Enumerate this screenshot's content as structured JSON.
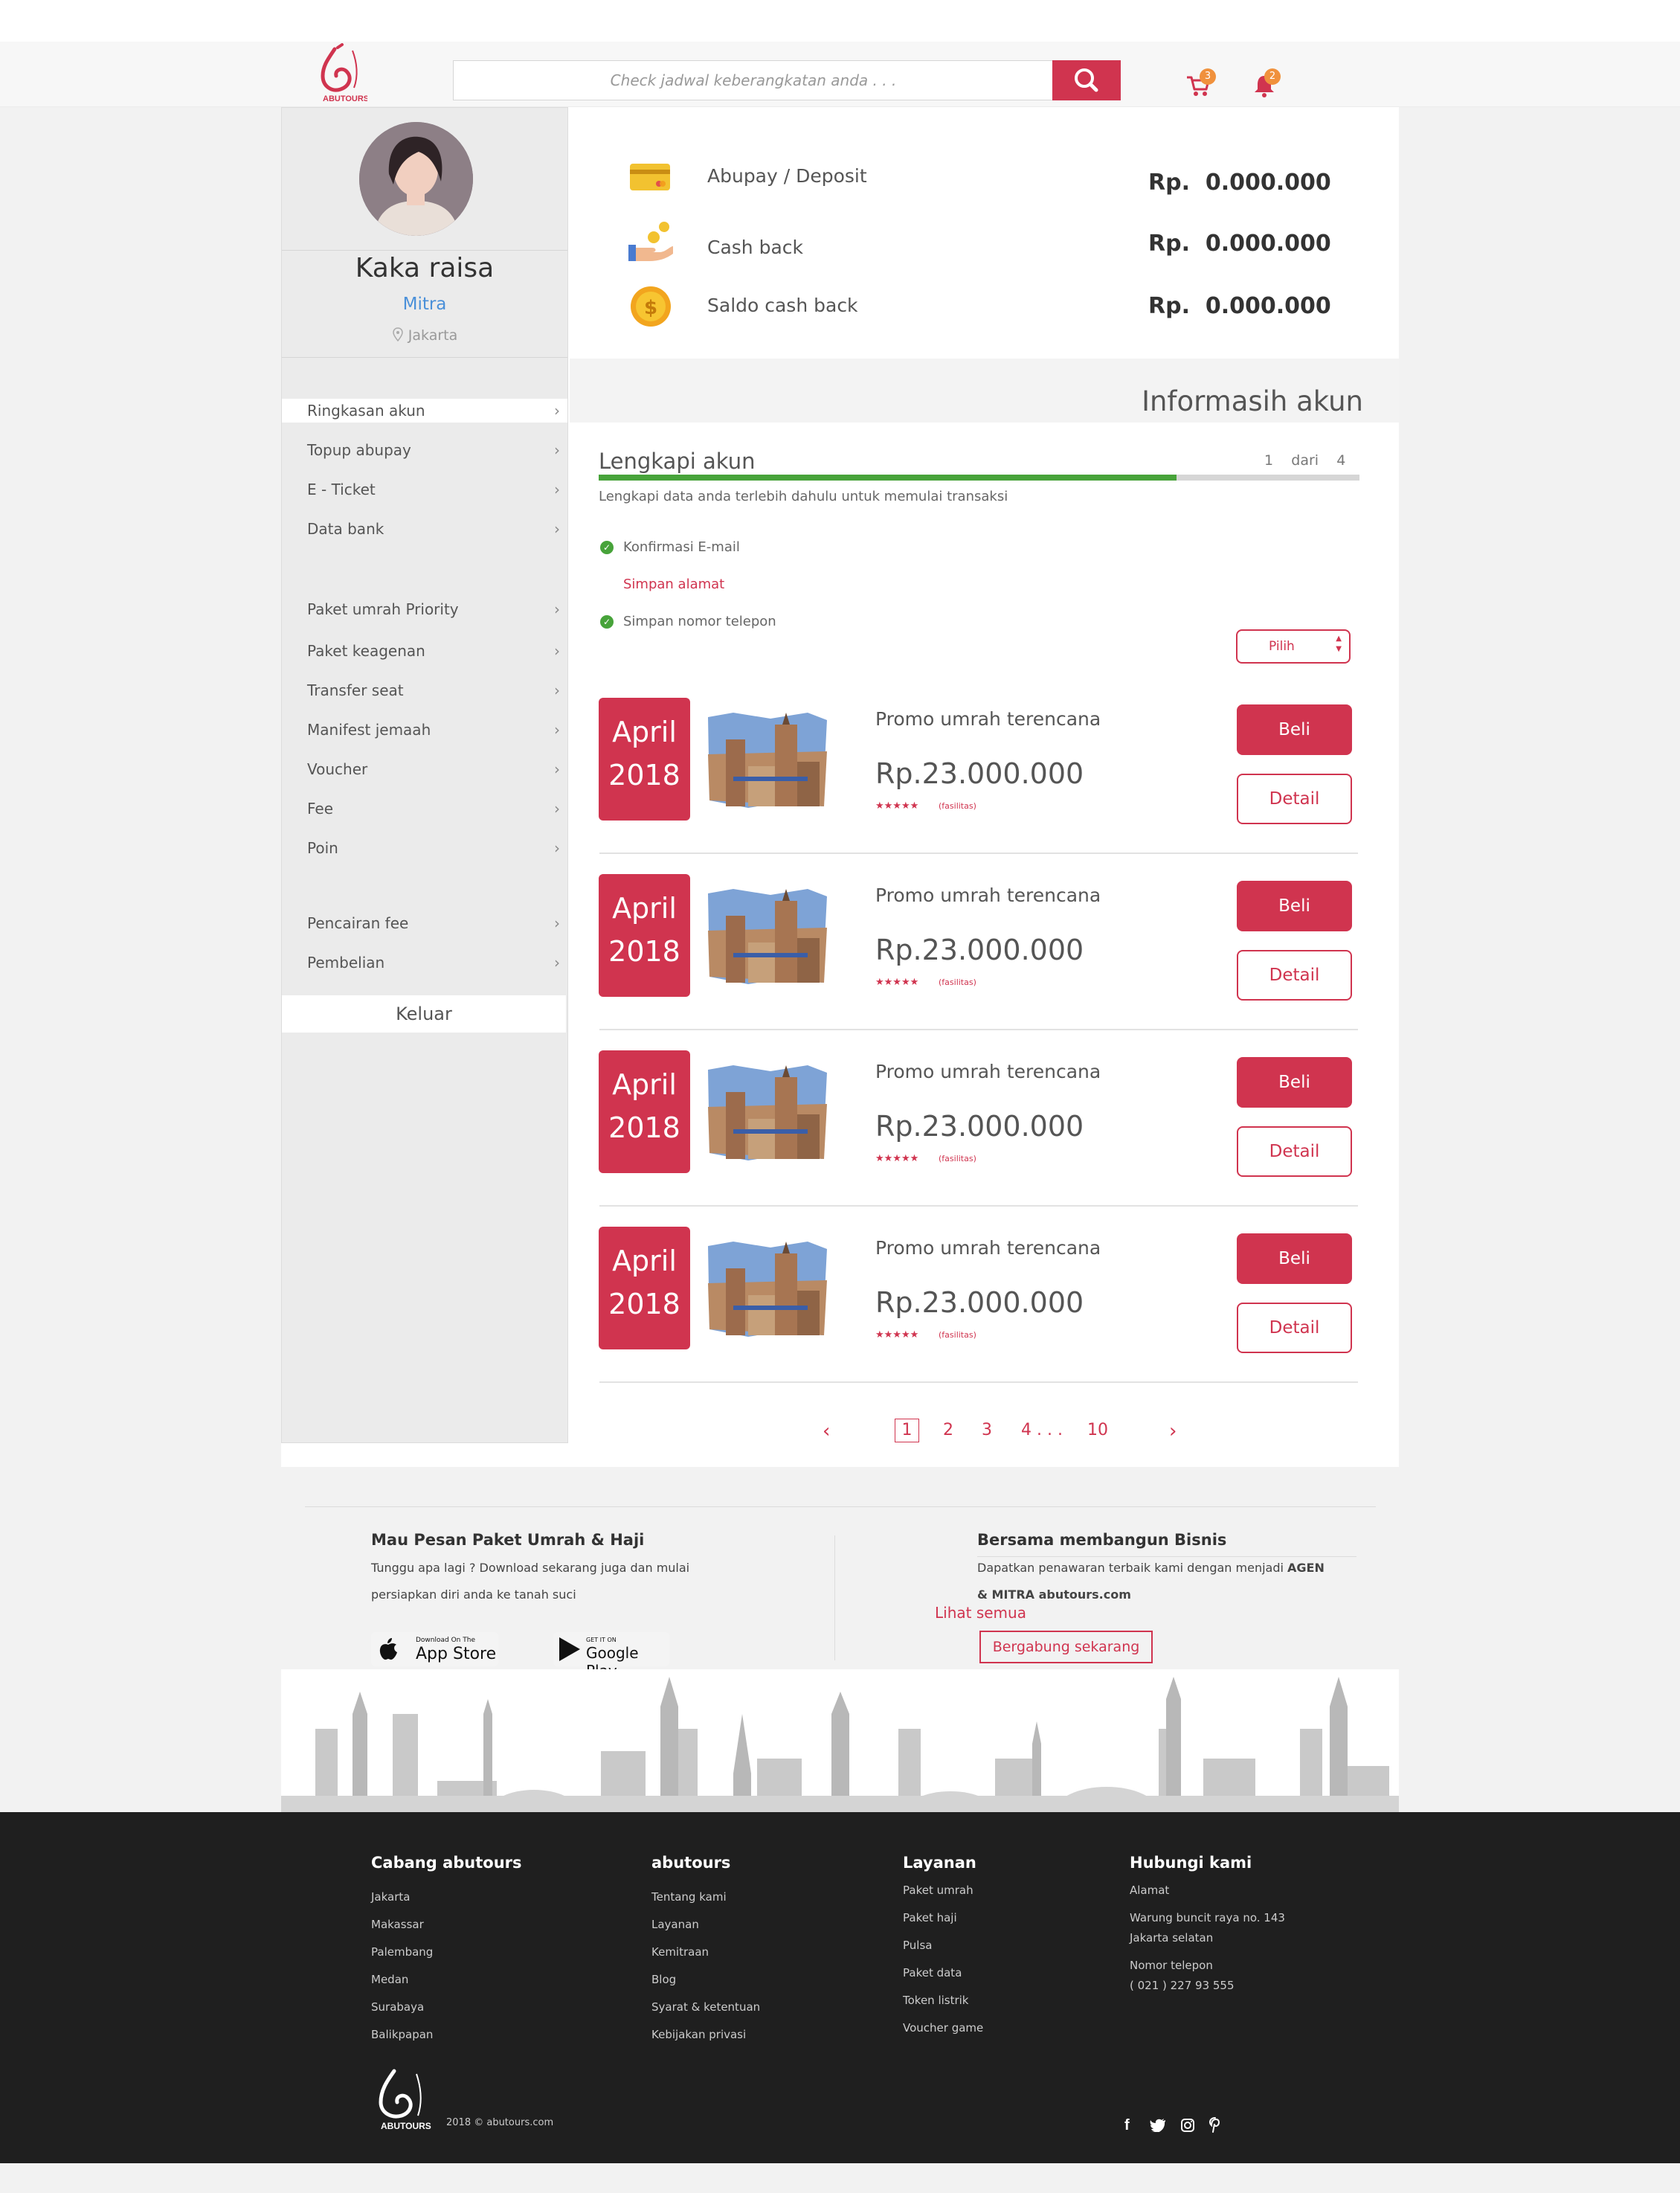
{
  "header": {
    "logo_text": "ABUTOURS",
    "search_placeholder": "Check jadwal keberangkatan anda . . .",
    "cart_count": "3",
    "notif_count": "2"
  },
  "profile": {
    "name": "Kaka raisa",
    "role": "Mitra",
    "city": "Jakarta"
  },
  "menu": {
    "group1": [
      "Ringkasan akun",
      "Topup abupay",
      "E - Ticket",
      "Data bank"
    ],
    "group2": [
      "Paket umrah Priority",
      "Paket keagenan",
      "Transfer seat",
      "Manifest jemaah",
      "Voucher",
      "Fee",
      "Poin"
    ],
    "group3": [
      "Pencairan fee",
      "Pembelian"
    ],
    "logout": "Keluar"
  },
  "balances": [
    {
      "label": "Abupay / Deposit",
      "currency": "Rp.",
      "value": "0.000.000",
      "icon": "card-icon"
    },
    {
      "label": "Cash back",
      "currency": "Rp.",
      "value": "0.000.000",
      "icon": "hand-coin-icon"
    },
    {
      "label": "Saldo cash back",
      "currency": "Rp.",
      "value": "0.000.000",
      "icon": "dollar-coin-icon"
    }
  ],
  "info_title": "Informasih akun",
  "lengkapi": {
    "title": "Lengkapi akun",
    "step_current": "1",
    "step_word": "dari",
    "step_total": "4",
    "progress": 0.76,
    "subtitle": "Lengkapi data anda terlebih dahulu untuk memulai transaksi",
    "steps": [
      {
        "label": "Konfirmasi E-mail",
        "done": true
      },
      {
        "label": "Simpan alamat",
        "done": false
      },
      {
        "label": "Simpan nomor telepon",
        "done": true
      }
    ]
  },
  "select": {
    "value": "Pilih"
  },
  "cards": [
    {
      "month": "April",
      "year": "2018",
      "title": "Promo umrah terencana",
      "price": "Rp.23.000.000",
      "stars": "★★★★★",
      "facilities": "(fasilitas)",
      "buy": "Beli",
      "detail": "Detail"
    },
    {
      "month": "April",
      "year": "2018",
      "title": "Promo umrah terencana",
      "price": "Rp.23.000.000",
      "stars": "★★★★★",
      "facilities": "(fasilitas)",
      "buy": "Beli",
      "detail": "Detail"
    },
    {
      "month": "April",
      "year": "2018",
      "title": "Promo umrah terencana",
      "price": "Rp.23.000.000",
      "stars": "★★★★★",
      "facilities": "(fasilitas)",
      "buy": "Beli",
      "detail": "Detail"
    },
    {
      "month": "April",
      "year": "2018",
      "title": "Promo umrah terencana",
      "price": "Rp.23.000.000",
      "stars": "★★★★★",
      "facilities": "(fasilitas)",
      "buy": "Beli",
      "detail": "Detail"
    }
  ],
  "pagination": {
    "pages": [
      "1",
      "2",
      "3",
      "4 . . .",
      "10"
    ],
    "active": "1"
  },
  "download": {
    "heading": "Mau Pesan Paket Umrah & Haji",
    "line1": "Tunggu apa lagi ? Download sekarang juga dan mulai",
    "line2": "persiapkan diri anda ke tanah suci",
    "appstore_small": "Download On The",
    "appstore_big": "App Store",
    "gplay_small": "GET IT ON",
    "gplay_big": "Google Play"
  },
  "bisnis": {
    "heading": "Bersama membangun Bisnis",
    "line1": "Dapatkan penawaran terbaik kami dengan menjadi",
    "line1_bold": "AGEN",
    "line2": "& MITRA abutours.com",
    "lihat": "Lihat semua",
    "join": "Bergabung sekarang"
  },
  "footer": {
    "col1": {
      "title": "Cabang abutours",
      "items": [
        "Jakarta",
        "Makassar",
        "Palembang",
        "Medan",
        "Surabaya",
        "Balikpapan"
      ]
    },
    "col2": {
      "title": "abutours",
      "items": [
        "Tentang kami",
        "Layanan",
        "Kemitraan",
        "Blog",
        "Syarat & ketentuan",
        "Kebijakan privasi"
      ]
    },
    "col3": {
      "title": "Layanan",
      "items": [
        "Paket umrah",
        "Paket haji",
        "Pulsa",
        "Paket data",
        "Token listrik",
        "Voucher game"
      ]
    },
    "col4": {
      "title": "Hubungi kami",
      "address_label": "Alamat",
      "address1": "Warung buncit raya no. 143",
      "address2": "Jakarta selatan",
      "phone_label": "Nomor telepon",
      "phone": "( 021 )  227 93 555"
    },
    "copyright": "2018 © abutours.com",
    "social": [
      "facebook-icon",
      "twitter-icon",
      "instagram-icon",
      "pinterest-icon"
    ]
  },
  "colors": {
    "accent": "#d0344f",
    "success": "#47a33a",
    "footer_bg": "#1f1f1f"
  }
}
